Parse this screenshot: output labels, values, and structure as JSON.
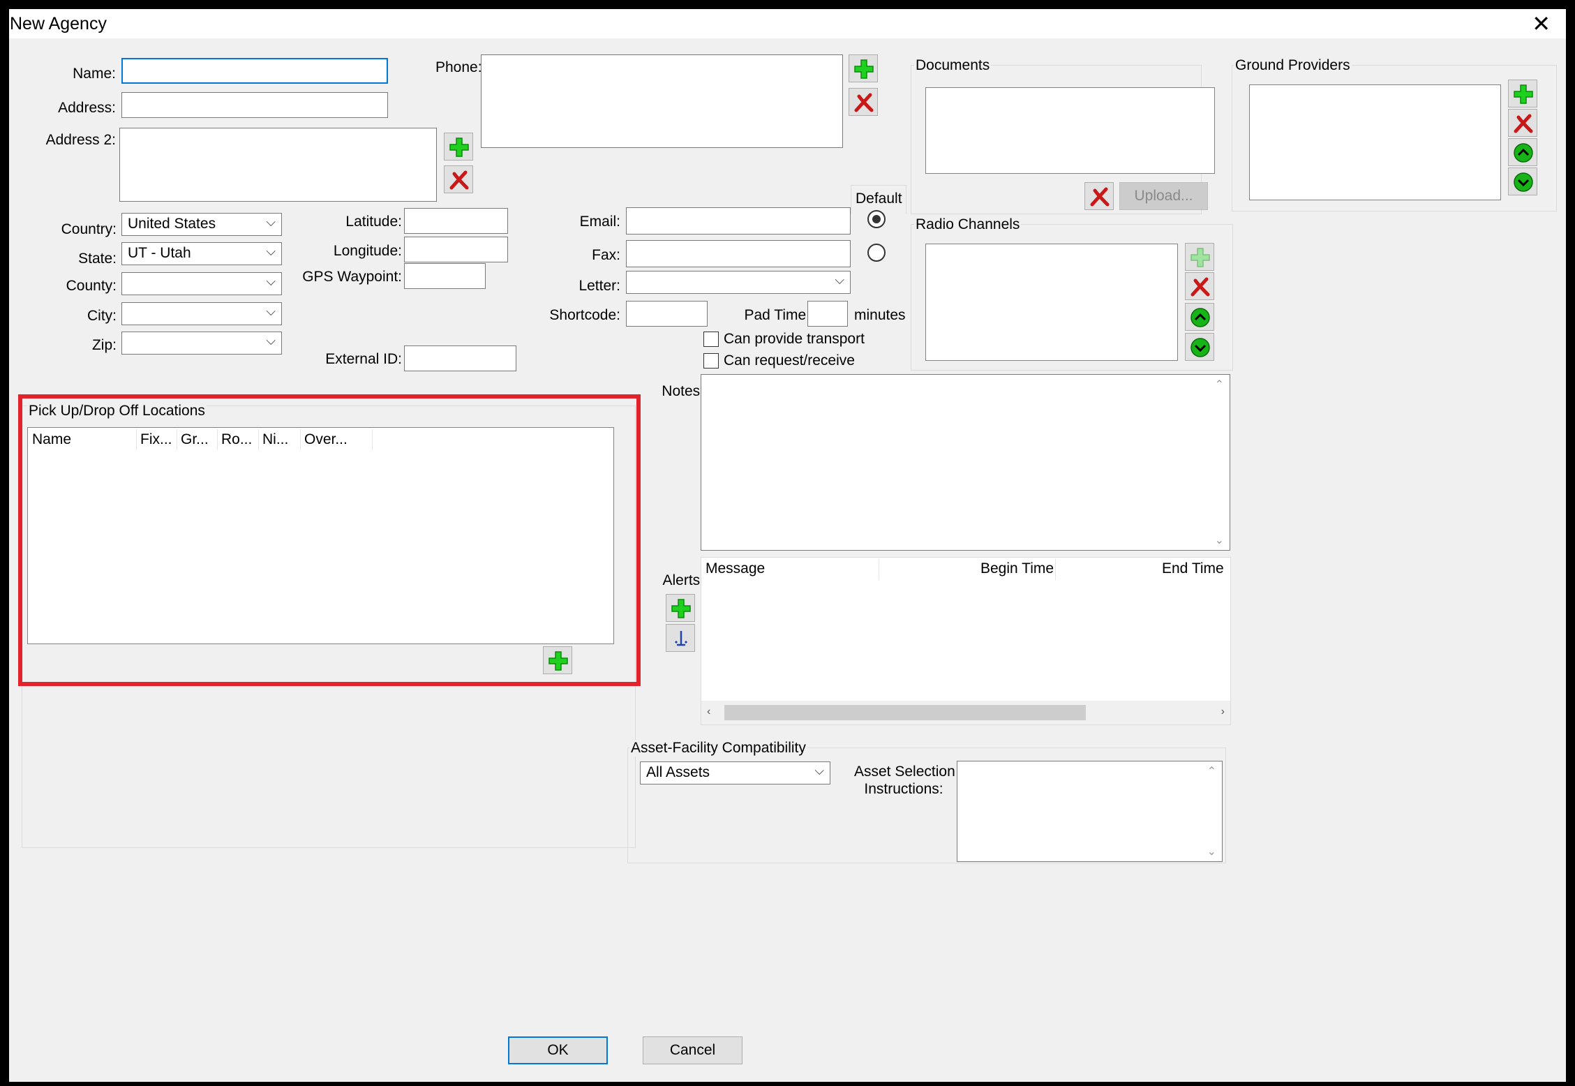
{
  "window": {
    "title": "New Agency",
    "close_glyph": "✕"
  },
  "form": {
    "name_label": "Name:",
    "name_value": "",
    "address_label": "Address:",
    "address_value": "",
    "address2_label": "Address 2:",
    "country_label": "Country:",
    "country_value": "United States",
    "state_label": "State:",
    "state_value": "UT - Utah",
    "county_label": "County:",
    "county_value": "",
    "city_label": "City:",
    "city_value": "",
    "zip_label": "Zip:",
    "zip_value": "",
    "phone_label": "Phone:",
    "latitude_label": "Latitude:",
    "longitude_label": "Longitude:",
    "gps_label": "GPS Waypoint:",
    "external_id_label": "External ID:",
    "default_label": "Default",
    "email_label": "Email:",
    "fax_label": "Fax:",
    "letter_label": "Letter:",
    "shortcode_label": "Shortcode:",
    "pad_time_label": "Pad Time:",
    "minutes_label": "minutes",
    "can_provide_transport": "Can provide transport",
    "can_request_receive": "Can request/receive",
    "notes_label": "Notes:",
    "alerts_label": "Alerts:"
  },
  "documents": {
    "title": "Documents",
    "upload_label": "Upload..."
  },
  "ground_providers": {
    "title": "Ground Providers"
  },
  "radio_channels": {
    "title": "Radio Channels"
  },
  "pickup": {
    "title": "Pick Up/Drop Off Locations",
    "columns": [
      "Name",
      "Fix...",
      "Gr...",
      "Ro...",
      "Ni...",
      "Over..."
    ]
  },
  "alerts_table": {
    "columns": [
      "Message",
      "Begin Time",
      "End Time"
    ]
  },
  "asset": {
    "title": "Asset-Facility Compatibility",
    "select_value": "All Assets",
    "instructions_label_1": "Asset Selection",
    "instructions_label_2": "Instructions:"
  },
  "buttons": {
    "ok": "OK",
    "cancel": "Cancel"
  },
  "colors": {
    "accent": "#0078d7",
    "add_green": "#22c522",
    "remove_red": "#cc1111",
    "highlight_red": "#e3232c"
  }
}
